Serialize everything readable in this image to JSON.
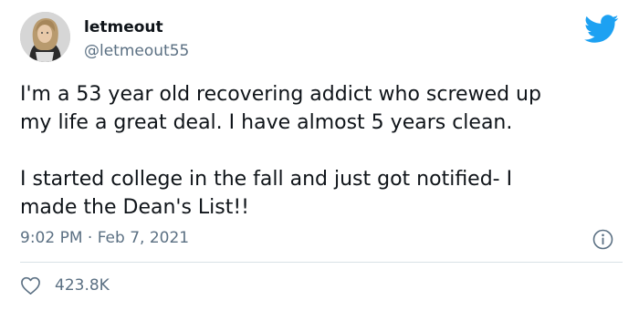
{
  "user": {
    "display_name": "letmeout",
    "handle": "@letmeout55",
    "avatar_icon": "profile-photo"
  },
  "tweet": {
    "paragraphs": [
      [
        "I'm a 53 year old recovering addict who screwed up",
        "my life a great deal. I have almost 5 years clean."
      ],
      [
        "I started college in the fall and just got notified- I",
        "made the Dean's List!!"
      ]
    ],
    "timestamp": "9:02 PM · Feb 7, 2021",
    "likes": "423.8K"
  },
  "icons": {
    "brand": "twitter-bird-icon",
    "info": "info-icon",
    "like": "heart-icon"
  },
  "colors": {
    "brand_blue": "#1da1f2",
    "text_primary": "#0f1419",
    "text_secondary": "#5b7083",
    "divider": "#d9e1e6"
  }
}
